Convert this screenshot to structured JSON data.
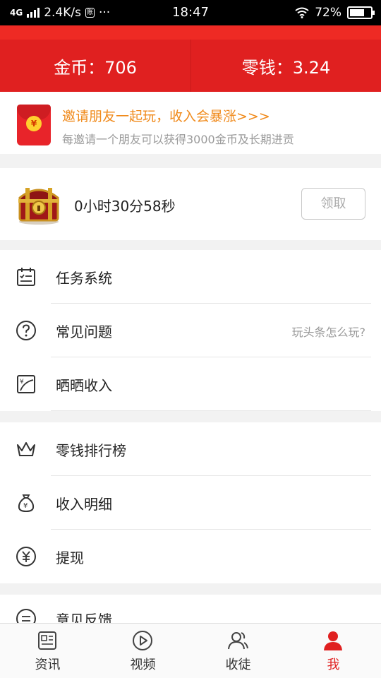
{
  "status_bar": {
    "network": "4G",
    "speed": "2.4K/s",
    "speed_icon_text": "账",
    "dots": "···",
    "time": "18:47",
    "battery": "72%",
    "battery_level": 0.72
  },
  "header": {
    "coins_label": "金币：706",
    "change_label": "零钱：3.24",
    "bg_color": "#e02020"
  },
  "invite": {
    "title": "邀请朋友一起玩，收入会暴涨>>>",
    "subtitle": "每邀请一个朋友可以获得3000金币及长期进贡",
    "coin_symbol": "¥",
    "title_color": "#f08a1b"
  },
  "chest": {
    "timer": "0小时30分58秒",
    "claim_button": "领取",
    "icon": "treasure-chest-icon"
  },
  "menu_group_1": [
    {
      "label": "任务系统",
      "hint": "",
      "icon": "task-calendar-icon"
    },
    {
      "label": "常见问题",
      "hint": "玩头条怎么玩?",
      "icon": "question-circle-icon"
    },
    {
      "label": "晒晒收入",
      "hint": "",
      "icon": "income-chart-icon"
    }
  ],
  "menu_group_2": [
    {
      "label": "零钱排行榜",
      "hint": "",
      "icon": "crown-icon"
    },
    {
      "label": "收入明细",
      "hint": "",
      "icon": "money-bag-icon"
    },
    {
      "label": "提现",
      "hint": "",
      "icon": "yen-circle-icon"
    }
  ],
  "menu_group_3": [
    {
      "label": "意见反馈",
      "hint": "",
      "icon": "feedback-icon"
    }
  ],
  "tabs": [
    {
      "label": "资讯",
      "icon": "news-icon",
      "active": false
    },
    {
      "label": "视频",
      "icon": "play-icon",
      "active": false
    },
    {
      "label": "收徒",
      "icon": "disciples-icon",
      "active": false
    },
    {
      "label": "我",
      "icon": "me-icon",
      "active": true
    }
  ],
  "colors": {
    "accent": "#e02020",
    "hint_gray": "#999999"
  }
}
